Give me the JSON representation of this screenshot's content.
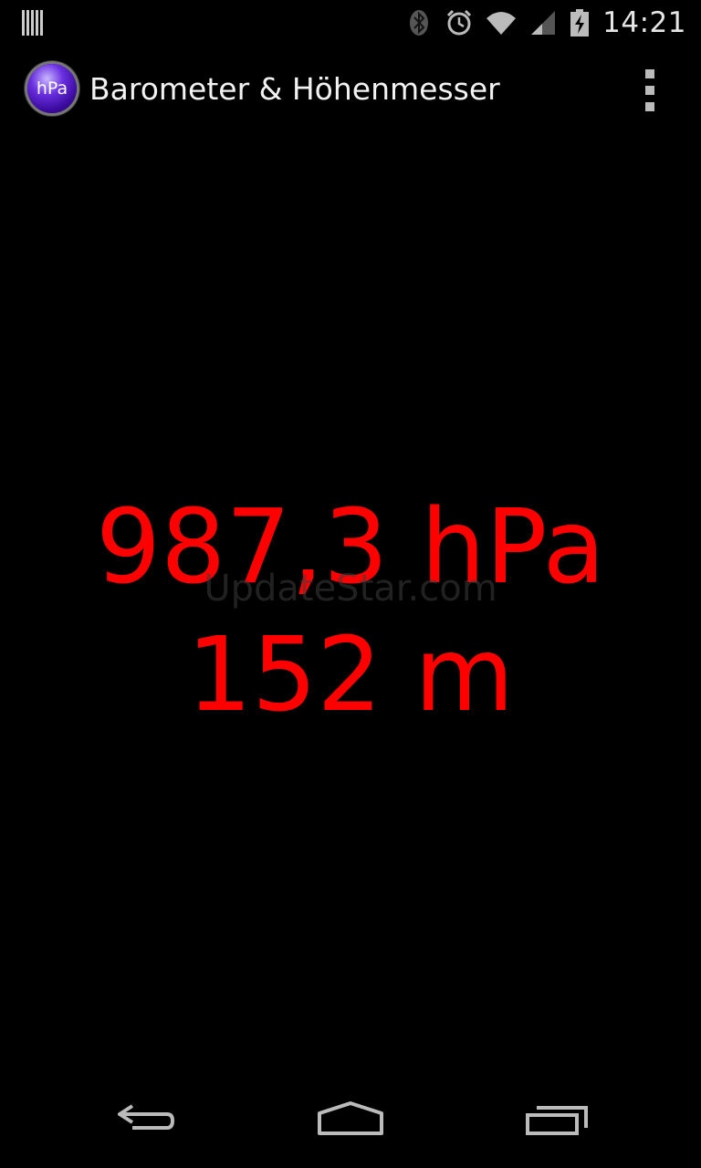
{
  "status_bar": {
    "time": "14:21",
    "icons": [
      "barcode-icon",
      "bluetooth-icon",
      "alarm-icon",
      "wifi-icon",
      "signal-icon",
      "battery-charging-icon"
    ]
  },
  "action_bar": {
    "app_icon_text": "hPa",
    "title": "Barometer & Höhenmesser",
    "menu_icon": "overflow-menu-icon"
  },
  "main": {
    "pressure": "987,3 hPa",
    "altitude": "152 m",
    "watermark": "UpdateStar.com"
  },
  "nav_bar": {
    "icons": [
      "back-icon",
      "home-icon",
      "recents-icon"
    ]
  },
  "colors": {
    "background": "#000000",
    "reading_text": "#ff0000",
    "system_icons": "#bbbbbb"
  }
}
